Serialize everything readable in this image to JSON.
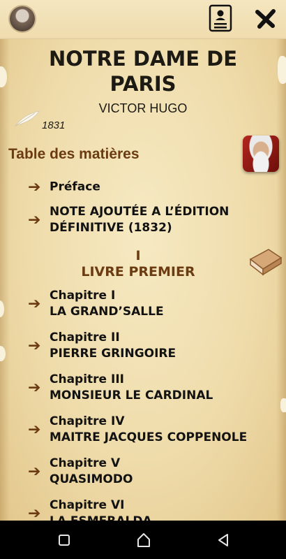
{
  "book": {
    "title_line1": "NOTRE DAME DE",
    "title_line2": "PARIS",
    "author": "VICTOR HUGO",
    "year": "1831"
  },
  "toc": {
    "heading": "Table des matières",
    "front_items": [
      {
        "line1": "Préface",
        "line2": ""
      },
      {
        "line1": "NOTE AJOUTÉE A L’ÉDITION",
        "line2": "DÉFINITIVE (1832)"
      }
    ],
    "part": {
      "number": "I",
      "title": "LIVRE PREMIER"
    },
    "chapters": [
      {
        "line1": "Chapitre I",
        "line2": "LA GRAND’SALLE"
      },
      {
        "line1": "Chapitre II",
        "line2": "PIERRE GRINGOIRE"
      },
      {
        "line1": "Chapitre III",
        "line2": "MONSIEUR LE CARDINAL"
      },
      {
        "line1": "Chapitre IV",
        "line2": "MAITRE JACQUES COPPENOLE"
      },
      {
        "line1": "Chapitre V",
        "line2": "QUASIMODO"
      },
      {
        "line1": "Chapitre VI",
        "line2": "LA ESMERALDA"
      }
    ]
  },
  "icons": {
    "arrow": "➔",
    "top_left": "author-avatar-icon",
    "doc": "document-icon",
    "close": "close-icon"
  },
  "colors": {
    "parchment": "#efdcab",
    "accent_brown": "#6b3b12",
    "text": "#121212"
  }
}
